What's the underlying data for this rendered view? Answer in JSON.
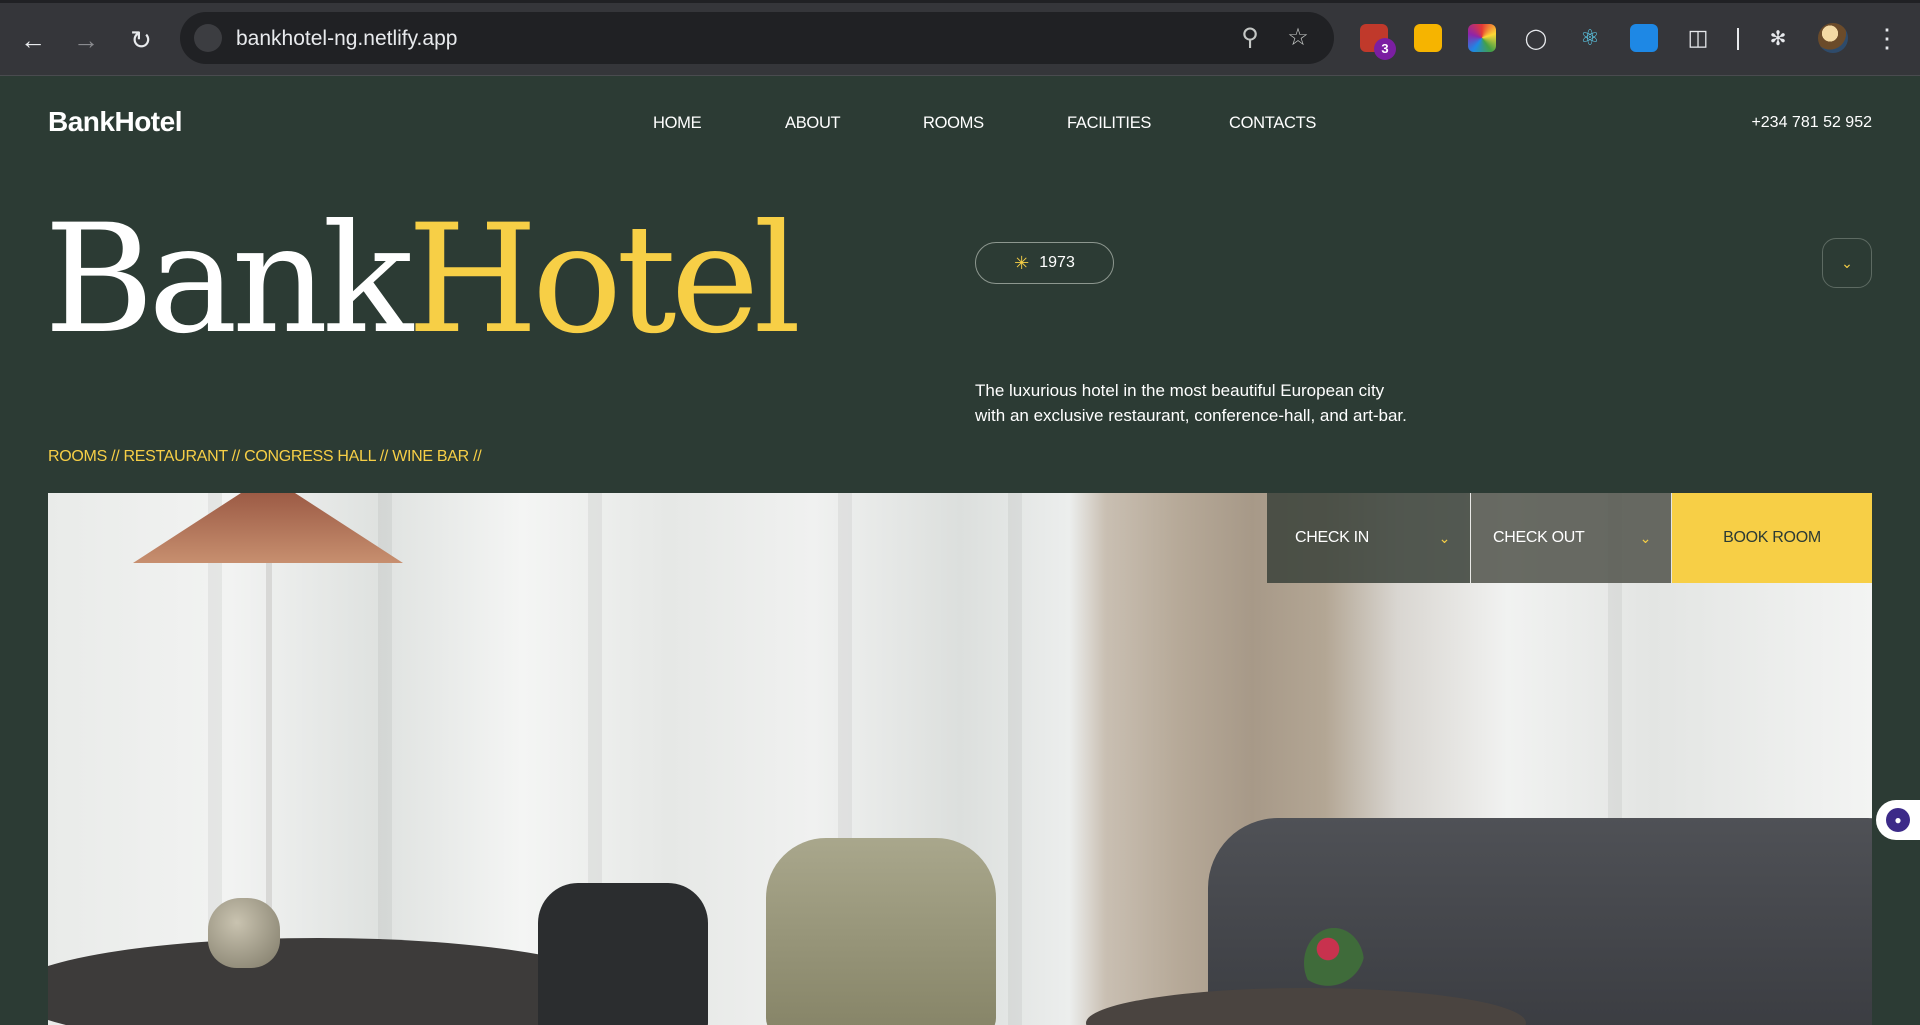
{
  "browser": {
    "url": "bankhotel-ng.netlify.app",
    "extension_badge": "3"
  },
  "header": {
    "logo": "BankHotel",
    "nav": [
      "HOME",
      "ABOUT",
      "ROOMS",
      "FACILITIES",
      "CONTACTS"
    ],
    "phone": "+234 781 52 952"
  },
  "hero": {
    "title_part1": "Bank",
    "title_part2": "Hotel",
    "year": "1973",
    "tagline_line1": "The luxurious hotel in the most beautiful European city",
    "tagline_line2": "with an exclusive restaurant, conference-hall, and art-bar.",
    "links": "ROOMS // RESTAURANT // CONGRESS HALL // WINE BAR //"
  },
  "booking": {
    "check_in": "CHECK IN",
    "check_out": "CHECK OUT",
    "book": "BOOK ROOM"
  },
  "colors": {
    "background": "#2c3b34",
    "accent": "#f7cf46"
  }
}
